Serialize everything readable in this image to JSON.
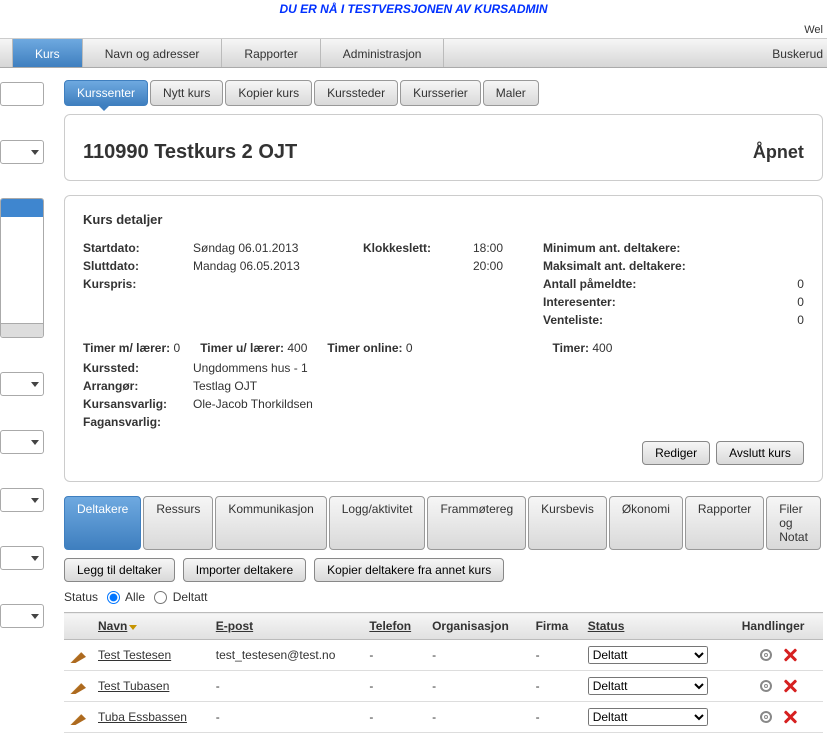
{
  "banner_text": "DU ER NÅ I TESTVERSJONEN AV KURSADMIN",
  "welcome_text": "Wel",
  "main_nav": {
    "tabs": [
      "Kurs",
      "Navn og adresser",
      "Rapporter",
      "Administrasjon"
    ],
    "right_label": "Buskerud"
  },
  "sub_tabs": [
    "Kurssenter",
    "Nytt kurs",
    "Kopier kurs",
    "Kurssteder",
    "Kursserier",
    "Maler"
  ],
  "course": {
    "title": "110990 Testkurs 2 OJT",
    "status": "Åpnet"
  },
  "details": {
    "heading": "Kurs detaljer",
    "labels": {
      "start": "Startdato:",
      "end": "Sluttdato:",
      "price": "Kurspris:",
      "time": "Klokkeslett:",
      "min": "Minimum ant. deltakere:",
      "max": "Maksimalt ant. deltakere:",
      "reg": "Antall påmeldte:",
      "int": "Interesenter:",
      "wait": "Venteliste:",
      "t_with": "Timer m/ lærer:",
      "t_wo": "Timer u/ lærer:",
      "t_online": "Timer online:",
      "t_total": "Timer:",
      "place": "Kurssted:",
      "arranger": "Arrangør:",
      "responsible": "Kursansvarlig:",
      "subject": "Fagansvarlig:"
    },
    "values": {
      "start": "Søndag 06.01.2013",
      "end": "Mandag 06.05.2013",
      "price": "",
      "time_start": "18:00",
      "time_end": "20:00",
      "min": "",
      "max": "",
      "reg": "0",
      "int": "0",
      "wait": "0",
      "t_with": "0",
      "t_wo": "400",
      "t_online": "0",
      "t_total": "400",
      "place": "Ungdommens hus - 1",
      "arranger": "Testlag OJT",
      "responsible": "Ole-Jacob Thorkildsen",
      "subject": ""
    },
    "buttons": {
      "edit": "Rediger",
      "close": "Avslutt kurs"
    }
  },
  "part_tabs": [
    "Deltakere",
    "Ressurs",
    "Kommunikasjon",
    "Logg/aktivitet",
    "Frammøtereg",
    "Kursbevis",
    "Økonomi",
    "Rapporter",
    "Filer og Notat"
  ],
  "toolbar": {
    "add": "Legg til deltaker",
    "import": "Importer deltakere",
    "copy": "Kopier deltakere fra annet kurs"
  },
  "status_row": {
    "label": "Status",
    "all": "Alle",
    "attended": "Deltatt"
  },
  "table": {
    "headers": [
      "",
      "Navn",
      "E-post",
      "Telefon",
      "Organisasjon",
      "Firma",
      "Status",
      "Handlinger"
    ],
    "rows": [
      {
        "name": "Test Testesen",
        "email": "test_testesen@test.no",
        "phone": "-",
        "org": "-",
        "firm": "-",
        "status": "Deltatt"
      },
      {
        "name": "Test Tubasen",
        "email": "-",
        "phone": "-",
        "org": "-",
        "firm": "-",
        "status": "Deltatt"
      },
      {
        "name": "Tuba Essbassen",
        "email": "-",
        "phone": "-",
        "org": "-",
        "firm": "-",
        "status": "Deltatt"
      }
    ]
  }
}
